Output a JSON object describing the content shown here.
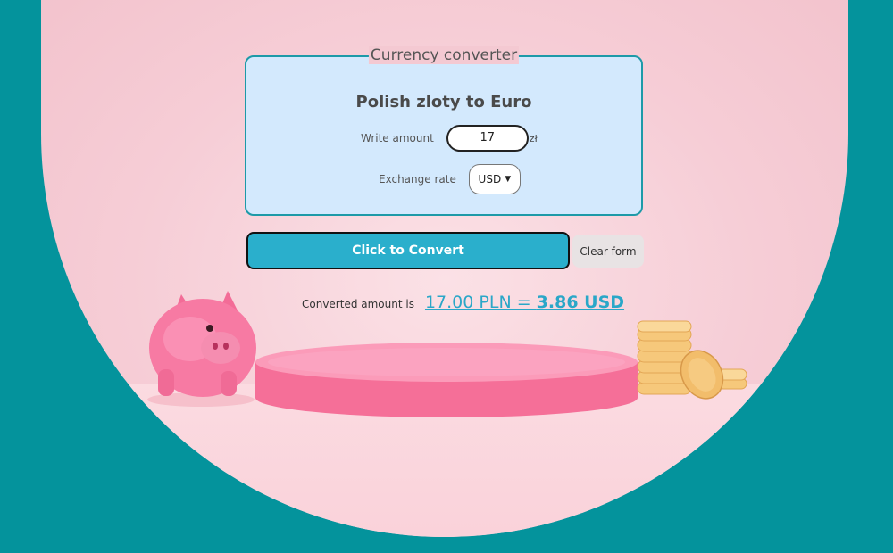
{
  "form": {
    "legend": "Currency converter",
    "heading": "Polish zloty to Euro",
    "amount_label": "Write amount",
    "amount_value": "17",
    "amount_unit": "zł",
    "rate_label": "Exchange rate",
    "rate_selected": "USD"
  },
  "buttons": {
    "convert": "Click to Convert",
    "clear": "Clear form"
  },
  "result": {
    "label": "Converted amount is",
    "from": "17.00 PLN = ",
    "to": "3.86 USD"
  },
  "colors": {
    "background": "#04939c",
    "accent": "#2aafcc",
    "panel": "#d3e9fd"
  },
  "icons": [
    "piggy-bank-icon",
    "podium-icon",
    "coins-icon",
    "chevron-down-icon"
  ]
}
